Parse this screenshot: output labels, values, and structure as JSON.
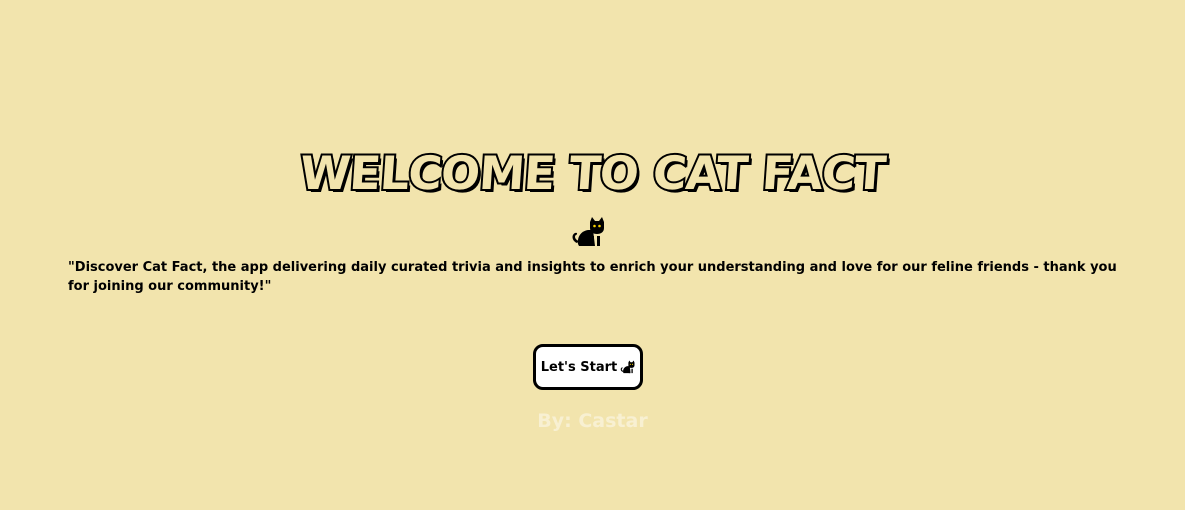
{
  "header": {
    "title": "WELCOME TO CAT FACT",
    "icon": "black-cat-icon"
  },
  "main": {
    "tagline": "\"Discover Cat Fact, the app delivering daily curated trivia and insights to enrich your understanding and love for our feline friends - thank you for joining our community!\"",
    "start_button": {
      "label": "Let's Start",
      "icon": "black-cat-icon"
    }
  },
  "footer": {
    "byline": "By: Castar"
  },
  "colors": {
    "background": "#f2e4ad",
    "title_fill": "#f2e4ad",
    "title_outline": "#000000",
    "button_bg": "#ffffff",
    "byline": "#f8f0d2"
  }
}
